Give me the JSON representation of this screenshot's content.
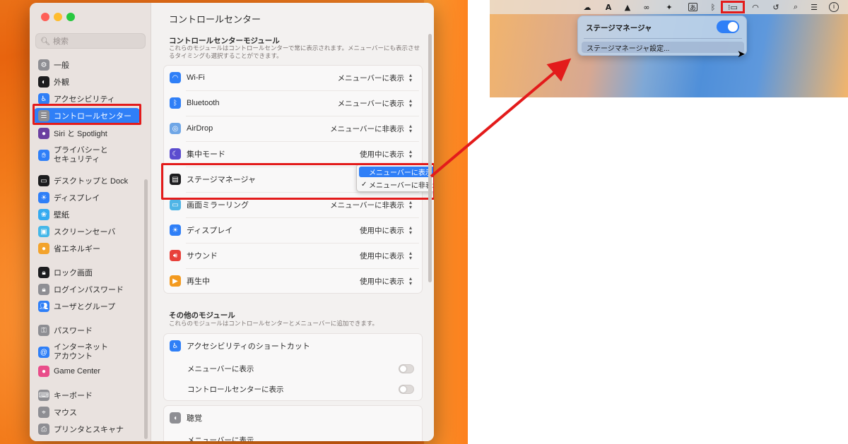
{
  "settings": {
    "search_placeholder": "検索",
    "sidebar": [
      {
        "label": "一般",
        "icon": "gear-icon",
        "color": "#8e8e93"
      },
      {
        "label": "外観",
        "icon": "appearance-icon",
        "color": "#1c1c1e"
      },
      {
        "label": "アクセシビリティ",
        "icon": "accessibility-icon",
        "color": "#2f7ff7"
      },
      {
        "label": "コントロールセンター",
        "icon": "control-center-icon",
        "color": "#8e8e93",
        "selected": true
      },
      {
        "label": "Siri と Spotlight",
        "icon": "siri-icon",
        "color": "#6b3fa0"
      },
      {
        "label": "プライバシーと\nセキュリティ",
        "icon": "privacy-hand-icon",
        "color": "#2f7ff7"
      },
      {
        "label": "デスクトップと Dock",
        "icon": "desktop-dock-icon",
        "color": "#1c1c1e"
      },
      {
        "label": "ディスプレイ",
        "icon": "display-icon",
        "color": "#2f7ff7"
      },
      {
        "label": "壁紙",
        "icon": "wallpaper-icon",
        "color": "#35aaf0"
      },
      {
        "label": "スクリーンセーバ",
        "icon": "screensaver-icon",
        "color": "#45b7e8"
      },
      {
        "label": "省エネルギー",
        "icon": "energy-saver-icon",
        "color": "#f3a32c"
      },
      {
        "label": "ロック画面",
        "icon": "lock-screen-icon",
        "color": "#1c1c1e"
      },
      {
        "label": "ログインパスワード",
        "icon": "login-password-icon",
        "color": "#8e8e93"
      },
      {
        "label": "ユーザとグループ",
        "icon": "users-groups-icon",
        "color": "#2f7ff7"
      },
      {
        "label": "パスワード",
        "icon": "password-key-icon",
        "color": "#8e8e93"
      },
      {
        "label": "インターネット\nアカウント",
        "icon": "internet-accounts-icon",
        "color": "#2f7ff7"
      },
      {
        "label": "Game Center",
        "icon": "game-center-icon",
        "color": "#e94d8a"
      },
      {
        "label": "キーボード",
        "icon": "keyboard-icon",
        "color": "#8e8e93"
      },
      {
        "label": "マウス",
        "icon": "mouse-icon",
        "color": "#8e8e93"
      },
      {
        "label": "プリンタとスキャナ",
        "icon": "printer-icon",
        "color": "#8e8e93"
      }
    ],
    "main": {
      "title": "コントロールセンター",
      "modules_title": "コントロールセンターモジュール",
      "modules_desc": "これらのモジュールはコントロールセンターで常に表示されます。メニューバーにも表示させるタイミングも選択することができます。",
      "modules": [
        {
          "label": "Wi-Fi",
          "value": "メニューバーに表示",
          "icon": "wifi-icon",
          "color": "#2f7ff7"
        },
        {
          "label": "Bluetooth",
          "value": "メニューバーに表示",
          "icon": "bluetooth-icon",
          "color": "#2f7ff7"
        },
        {
          "label": "AirDrop",
          "value": "メニューバーに非表示",
          "icon": "airdrop-icon",
          "color": "#6fa6e6"
        },
        {
          "label": "集中モード",
          "value": "使用中に表示",
          "icon": "focus-moon-icon",
          "color": "#5b4ccf"
        },
        {
          "label": "ステージマネージャ",
          "value": "",
          "icon": "stage-manager-icon",
          "color": "#1c1c1e"
        },
        {
          "label": "画面ミラーリング",
          "value": "メニューバーに非表示",
          "icon": "screen-mirroring-icon",
          "color": "#4fb5e6"
        },
        {
          "label": "ディスプレイ",
          "value": "使用中に表示",
          "icon": "display-brightness-icon",
          "color": "#2f7ff7"
        },
        {
          "label": "サウンド",
          "value": "使用中に表示",
          "icon": "sound-icon",
          "color": "#e8413a"
        },
        {
          "label": "再生中",
          "value": "使用中に表示",
          "icon": "now-playing-icon",
          "color": "#f39a1f"
        }
      ],
      "stage_popup": {
        "options": [
          "メニューバーに表示",
          "メニューバーに非表示"
        ],
        "checked": "メニューバーに非表示",
        "check_mark": "✓"
      },
      "other_title": "その他のモジュール",
      "other_desc": "これらのモジュールはコントロールセンターとメニューバーに追加できます。",
      "accessibility_shortcut": {
        "label": "アクセシビリティのショートカット",
        "sub": [
          "メニューバーに表示",
          "コントロールセンターに表示"
        ]
      },
      "hearing": {
        "label": "聴覚",
        "sub": [
          "メニューバーに表示"
        ]
      }
    }
  },
  "menubar": {
    "dropdown_title": "ステージマネージャ",
    "dropdown_toggle_on": true,
    "dropdown_item": "ステージマネージャ設定...",
    "icons": [
      "cloud-icon",
      "font-a-icon",
      "drive-icon",
      "creative-cloud-icon",
      "dropbox-icon",
      "input-method-icon",
      "bluetooth-icon",
      "stage-manager-icon",
      "wifi-icon",
      "time-machine-icon",
      "spotlight-search-icon",
      "control-center-icon",
      "info-icon"
    ],
    "input_method_label": "あ"
  },
  "accent_color": "#2f7ff7",
  "highlight_color": "#e31b1b"
}
